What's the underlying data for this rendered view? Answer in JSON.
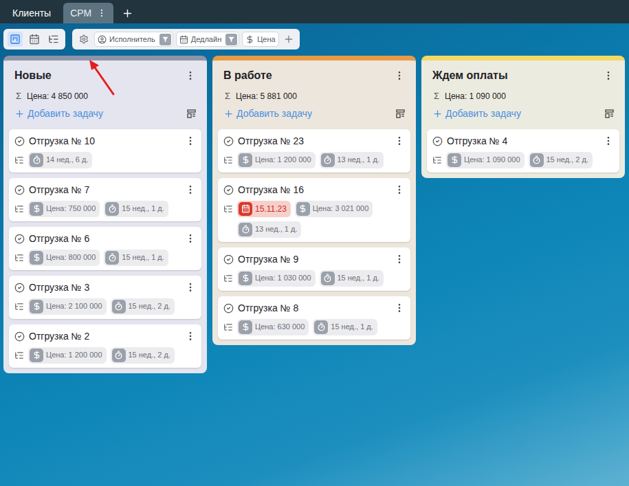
{
  "topbar": {
    "tabs": [
      {
        "label": "Клиенты",
        "selected": false
      },
      {
        "label": "CPM",
        "selected": true
      }
    ]
  },
  "toolbar": {
    "views": [
      {
        "name": "kanban",
        "selected": true
      },
      {
        "name": "calendar",
        "selected": false
      },
      {
        "name": "gantt",
        "selected": false
      }
    ],
    "filters": [
      {
        "label": "Исполнитель",
        "kind": "user",
        "filter": true
      },
      {
        "label": "Дедлайн",
        "kind": "date",
        "filter": true
      },
      {
        "label": "Цена",
        "kind": "price",
        "filter": false
      }
    ]
  },
  "columns": [
    {
      "title": "Новые",
      "color": "#8e95a8",
      "bg": "#e4e5ef",
      "sum_symbol": "Σ",
      "sum": "Цена: 4 850 000",
      "add_label": "Добавить задачу",
      "cards": [
        {
          "title": "Отгрузка № 10",
          "chips": [
            {
              "kind": "duration",
              "text": "14 нед., 6 д.",
              "overdue": false
            }
          ]
        },
        {
          "title": "Отгрузка № 7",
          "chips": [
            {
              "kind": "price",
              "text": "Цена: 750 000",
              "overdue": false
            },
            {
              "kind": "duration",
              "text": "15 нед., 1 д.",
              "overdue": false
            }
          ]
        },
        {
          "title": "Отгрузка № 6",
          "chips": [
            {
              "kind": "price",
              "text": "Цена: 800 000",
              "overdue": false
            },
            {
              "kind": "duration",
              "text": "15 нед., 1 д.",
              "overdue": false
            }
          ]
        },
        {
          "title": "Отгрузка № 3",
          "chips": [
            {
              "kind": "price",
              "text": "Цена: 2 100 000",
              "overdue": false
            },
            {
              "kind": "duration",
              "text": "15 нед., 2 д.",
              "overdue": false
            }
          ]
        },
        {
          "title": "Отгрузка № 2",
          "chips": [
            {
              "kind": "price",
              "text": "Цена: 1 200 000",
              "overdue": false
            },
            {
              "kind": "duration",
              "text": "15 нед., 2 д.",
              "overdue": false
            }
          ]
        }
      ]
    },
    {
      "title": "В работе",
      "color": "#e89a45",
      "bg": "#ede6dd",
      "sum_symbol": "Σ",
      "sum": "Цена: 5 881 000",
      "add_label": "Добавить задачу",
      "cards": [
        {
          "title": "Отгрузка № 23",
          "chips": [
            {
              "kind": "price",
              "text": "Цена: 1 200 000",
              "overdue": false
            },
            {
              "kind": "duration",
              "text": "13 нед., 1 д.",
              "overdue": false
            }
          ]
        },
        {
          "title": "Отгрузка № 16",
          "chips": [
            {
              "kind": "deadline",
              "text": "15.11.23",
              "overdue": true
            },
            {
              "kind": "price",
              "text": "Цена: 3 021 000",
              "overdue": false
            },
            {
              "kind": "duration",
              "text": "13 нед., 1 д.",
              "overdue": false
            }
          ]
        },
        {
          "title": "Отгрузка № 9",
          "chips": [
            {
              "kind": "price",
              "text": "Цена: 1 030 000",
              "overdue": false
            },
            {
              "kind": "duration",
              "text": "15 нед., 1 д.",
              "overdue": false
            }
          ]
        },
        {
          "title": "Отгрузка № 8",
          "chips": [
            {
              "kind": "price",
              "text": "Цена: 630 000",
              "overdue": false
            },
            {
              "kind": "duration",
              "text": "15 нед., 1 д.",
              "overdue": false
            }
          ]
        }
      ]
    },
    {
      "title": "Ждем оплаты",
      "color": "#f3d965",
      "bg": "#ecebe0",
      "sum_symbol": "Σ",
      "sum": "Цена: 1 090 000",
      "add_label": "Добавить задачу",
      "cards": [
        {
          "title": "Отгрузка № 4",
          "chips": [
            {
              "kind": "price",
              "text": "Цена: 1 090 000",
              "overdue": false
            },
            {
              "kind": "duration",
              "text": "15 нед., 2 д.",
              "overdue": false
            }
          ]
        }
      ]
    }
  ],
  "annotation": {
    "kind": "arrow",
    "color": "#e41e1e"
  }
}
